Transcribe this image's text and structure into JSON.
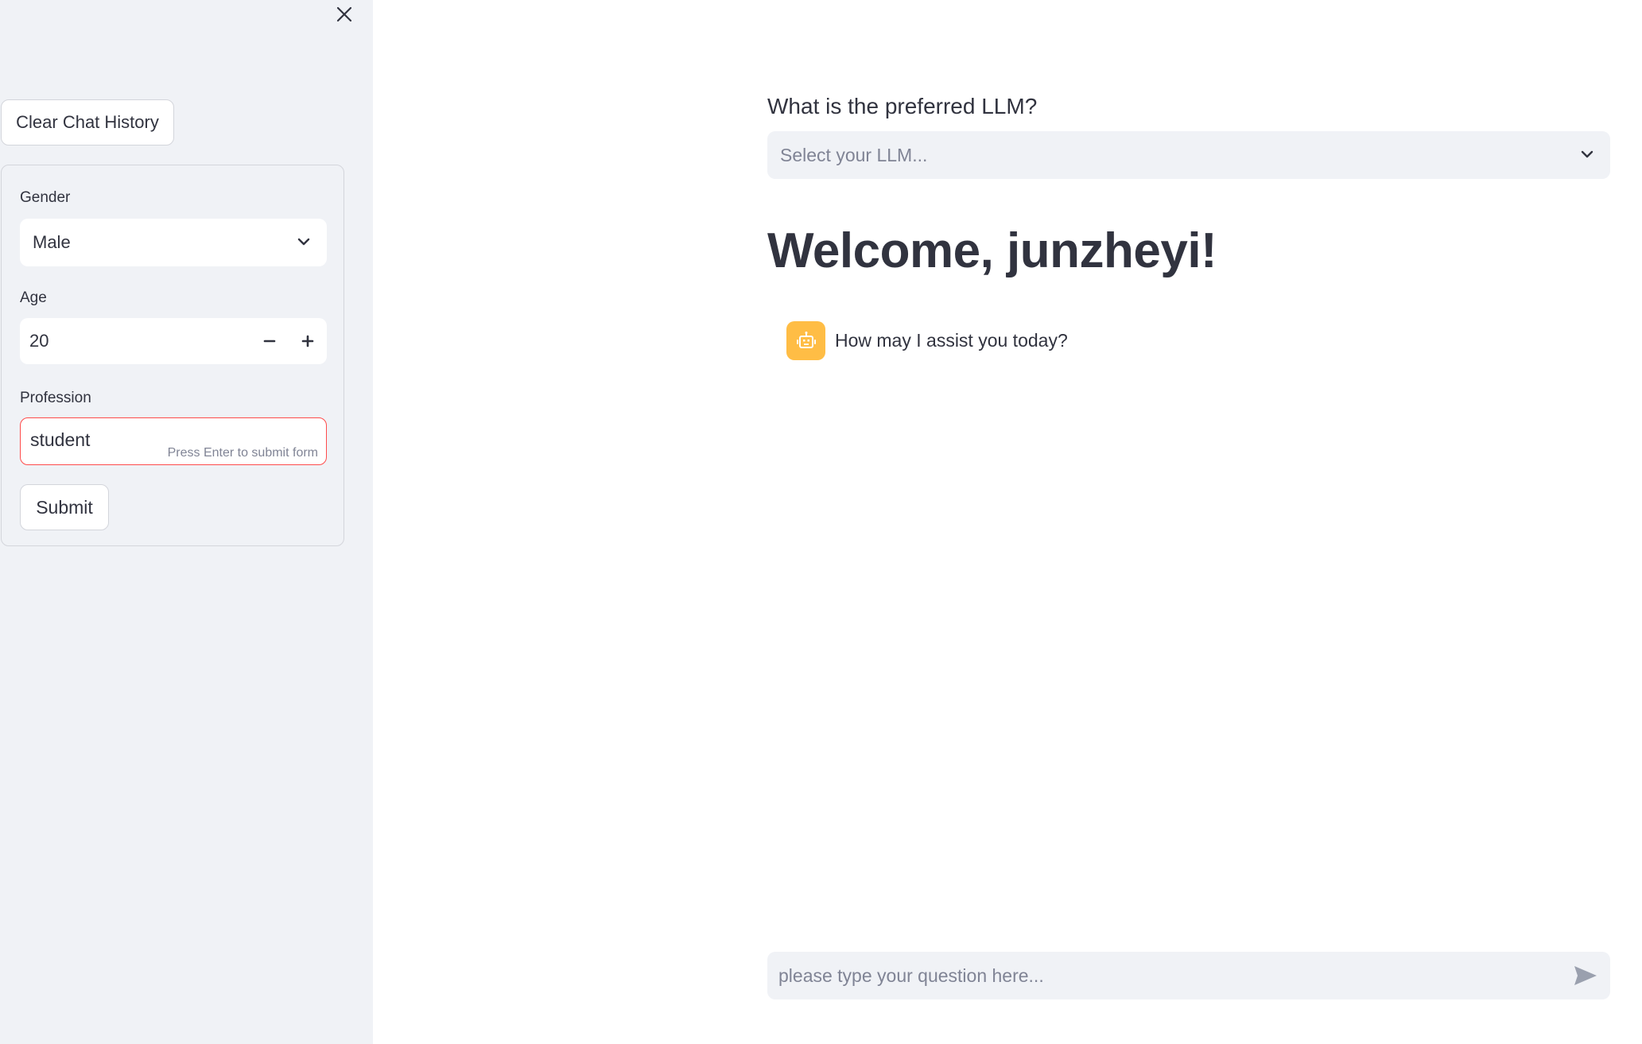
{
  "sidebar": {
    "close_icon": "close-icon",
    "clear_button_label": "Clear Chat History",
    "form": {
      "gender": {
        "label": "Gender",
        "value": "Male"
      },
      "age": {
        "label": "Age",
        "value": "20"
      },
      "profession": {
        "label": "Profession",
        "value": "student",
        "hint": "Press Enter to submit form"
      },
      "submit_label": "Submit"
    }
  },
  "main": {
    "llm_select": {
      "label": "What is the preferred LLM?",
      "placeholder": "Select your LLM..."
    },
    "welcome_title": "Welcome, junzheyi!",
    "messages": [
      {
        "role": "assistant",
        "avatar_icon": "robot-icon",
        "text": "How may I assist you today?"
      }
    ],
    "chat_input": {
      "placeholder": "please type your question here..."
    }
  },
  "colors": {
    "sidebar_bg": "#f0f2f6",
    "text": "#31333f",
    "muted_text": "#808495",
    "error_border": "#ff4b4b",
    "avatar_bg": "#ffbd45"
  }
}
